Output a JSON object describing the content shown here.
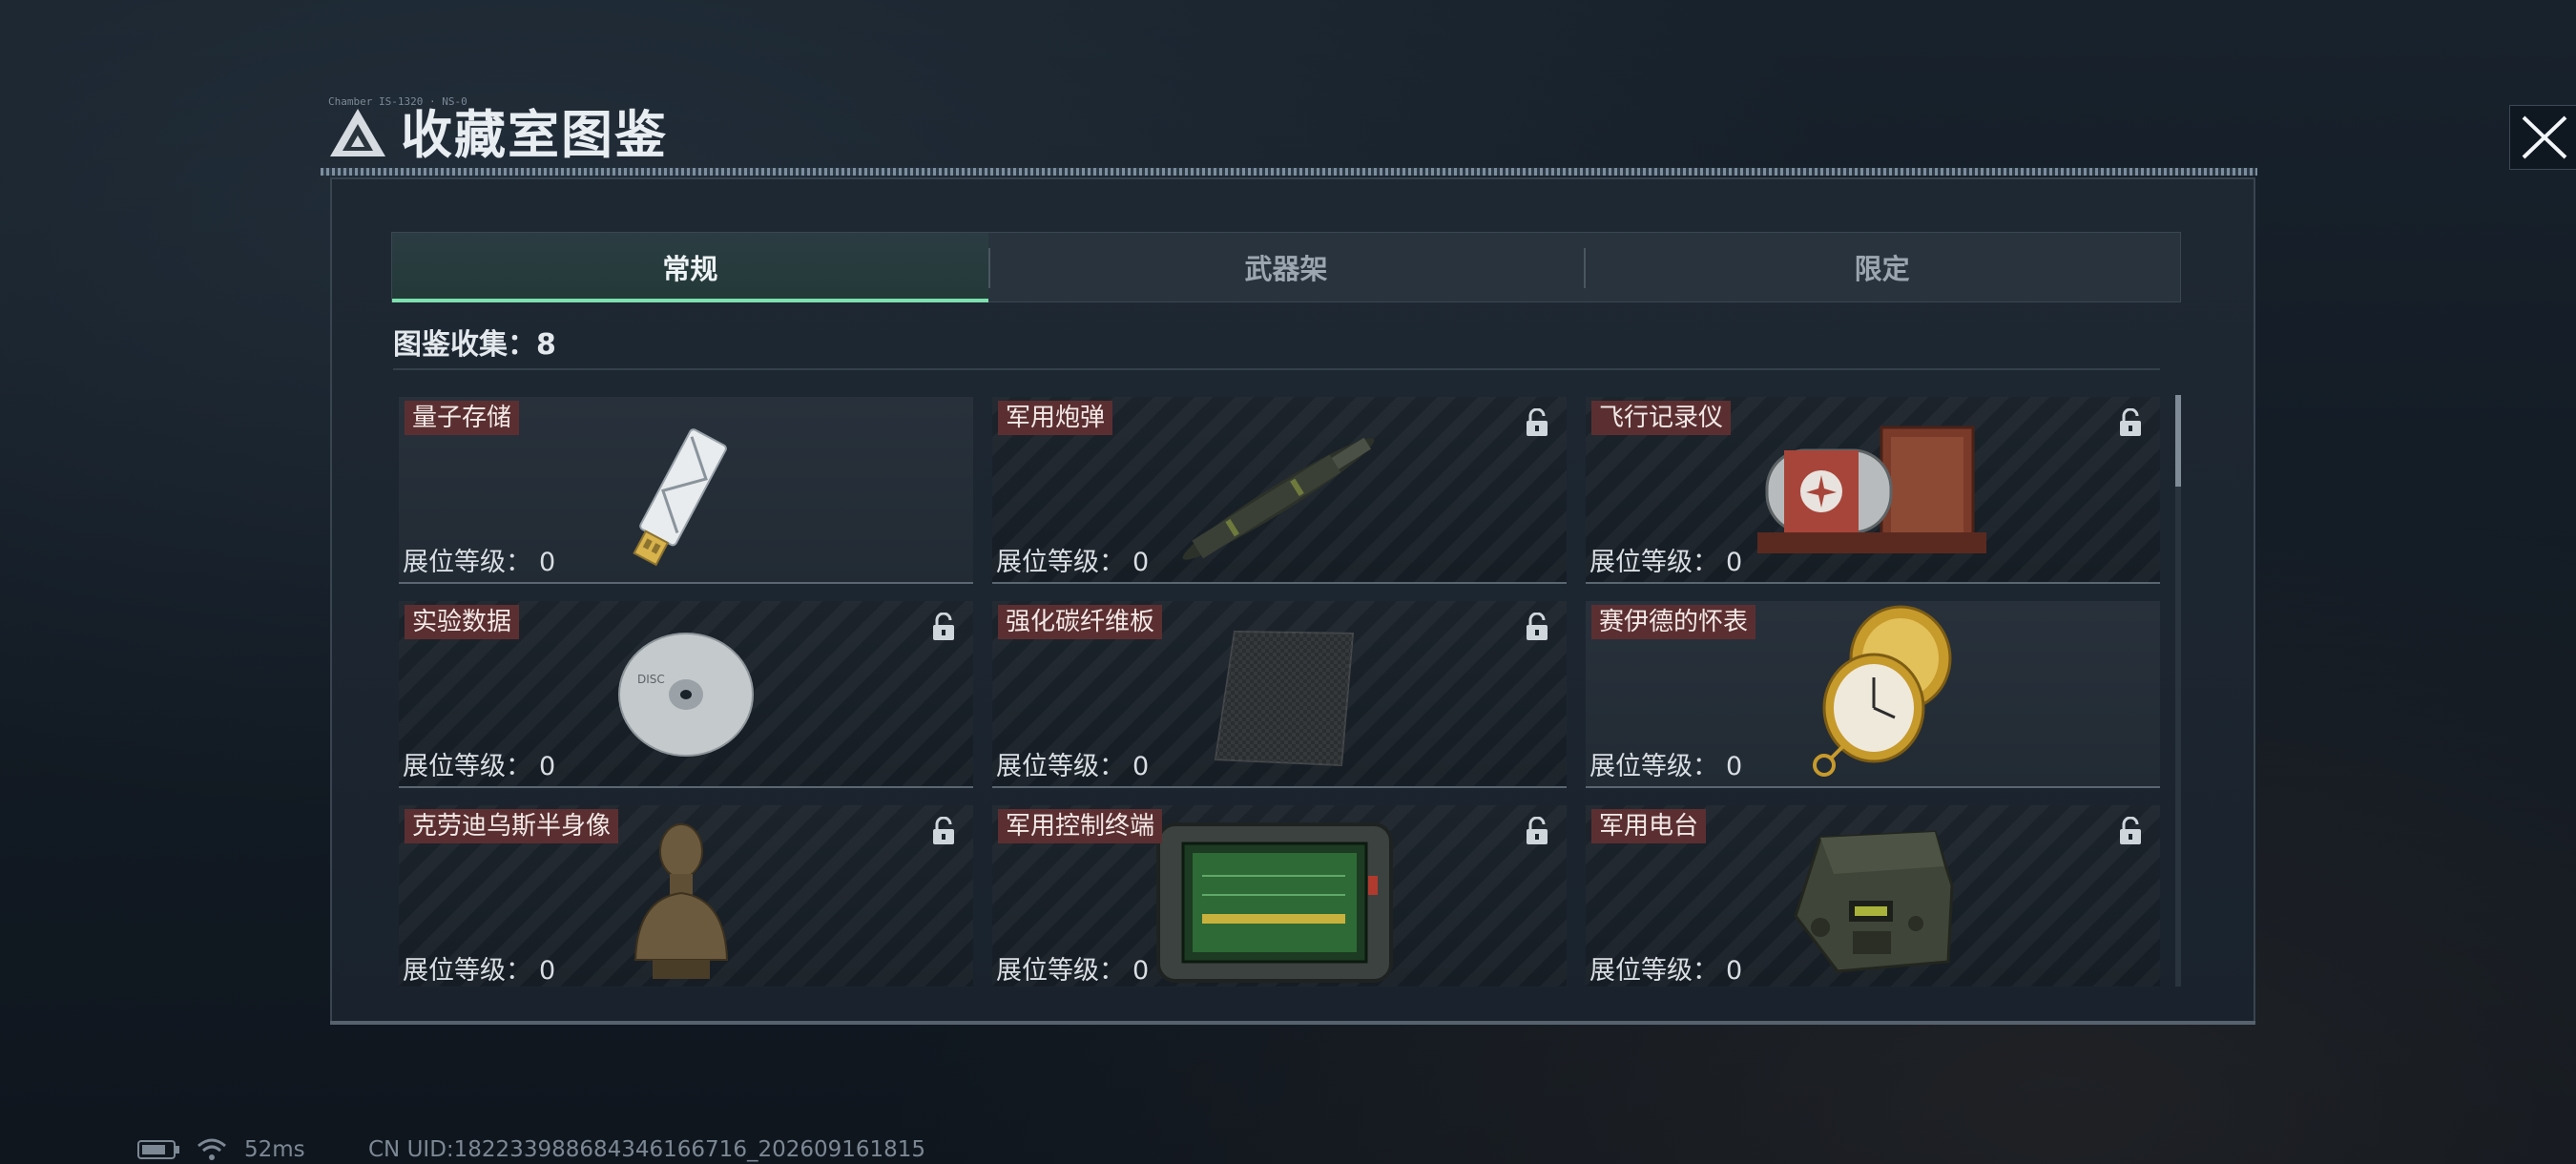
{
  "window": {
    "title": "收藏室图鉴",
    "caption": "Chamber IS-1320 · NS-0"
  },
  "tabs": [
    {
      "label": "常规",
      "active": true
    },
    {
      "label": "武器架",
      "active": false
    },
    {
      "label": "限定",
      "active": false
    }
  ],
  "collection": {
    "label": "图鉴收集：",
    "count": "8"
  },
  "items": [
    {
      "name": "量子存储",
      "level_label": "展位等级：",
      "level": "0",
      "locked": false,
      "icon": "usb-drive-icon"
    },
    {
      "name": "军用炮弹",
      "level_label": "展位等级：",
      "level": "0",
      "locked": true,
      "icon": "artillery-shell-icon"
    },
    {
      "name": "飞行记录仪",
      "level_label": "展位等级：",
      "level": "0",
      "locked": true,
      "icon": "flight-recorder-icon"
    },
    {
      "name": "实验数据",
      "level_label": "展位等级：",
      "level": "0",
      "locked": true,
      "icon": "disc-icon"
    },
    {
      "name": "强化碳纤维板",
      "level_label": "展位等级：",
      "level": "0",
      "locked": true,
      "icon": "carbon-plate-icon"
    },
    {
      "name": "赛伊德的怀表",
      "level_label": "展位等级：",
      "level": "0",
      "locked": false,
      "icon": "pocket-watch-icon"
    },
    {
      "name": "克劳迪乌斯半身像",
      "level_label": "展位等级：",
      "level": "0",
      "locked": true,
      "icon": "bust-icon"
    },
    {
      "name": "军用控制终端",
      "level_label": "展位等级：",
      "level": "0",
      "locked": true,
      "icon": "control-terminal-icon"
    },
    {
      "name": "军用电台",
      "level_label": "展位等级：",
      "level": "0",
      "locked": true,
      "icon": "radio-icon"
    }
  ],
  "status": {
    "ping": "52ms",
    "uid": "CN UID:1822339886843461667​16_202609161815"
  },
  "colors": {
    "accent": "#7ee0ae",
    "label_bg": "#5b2f31",
    "panel_bg": "#1e2833"
  }
}
